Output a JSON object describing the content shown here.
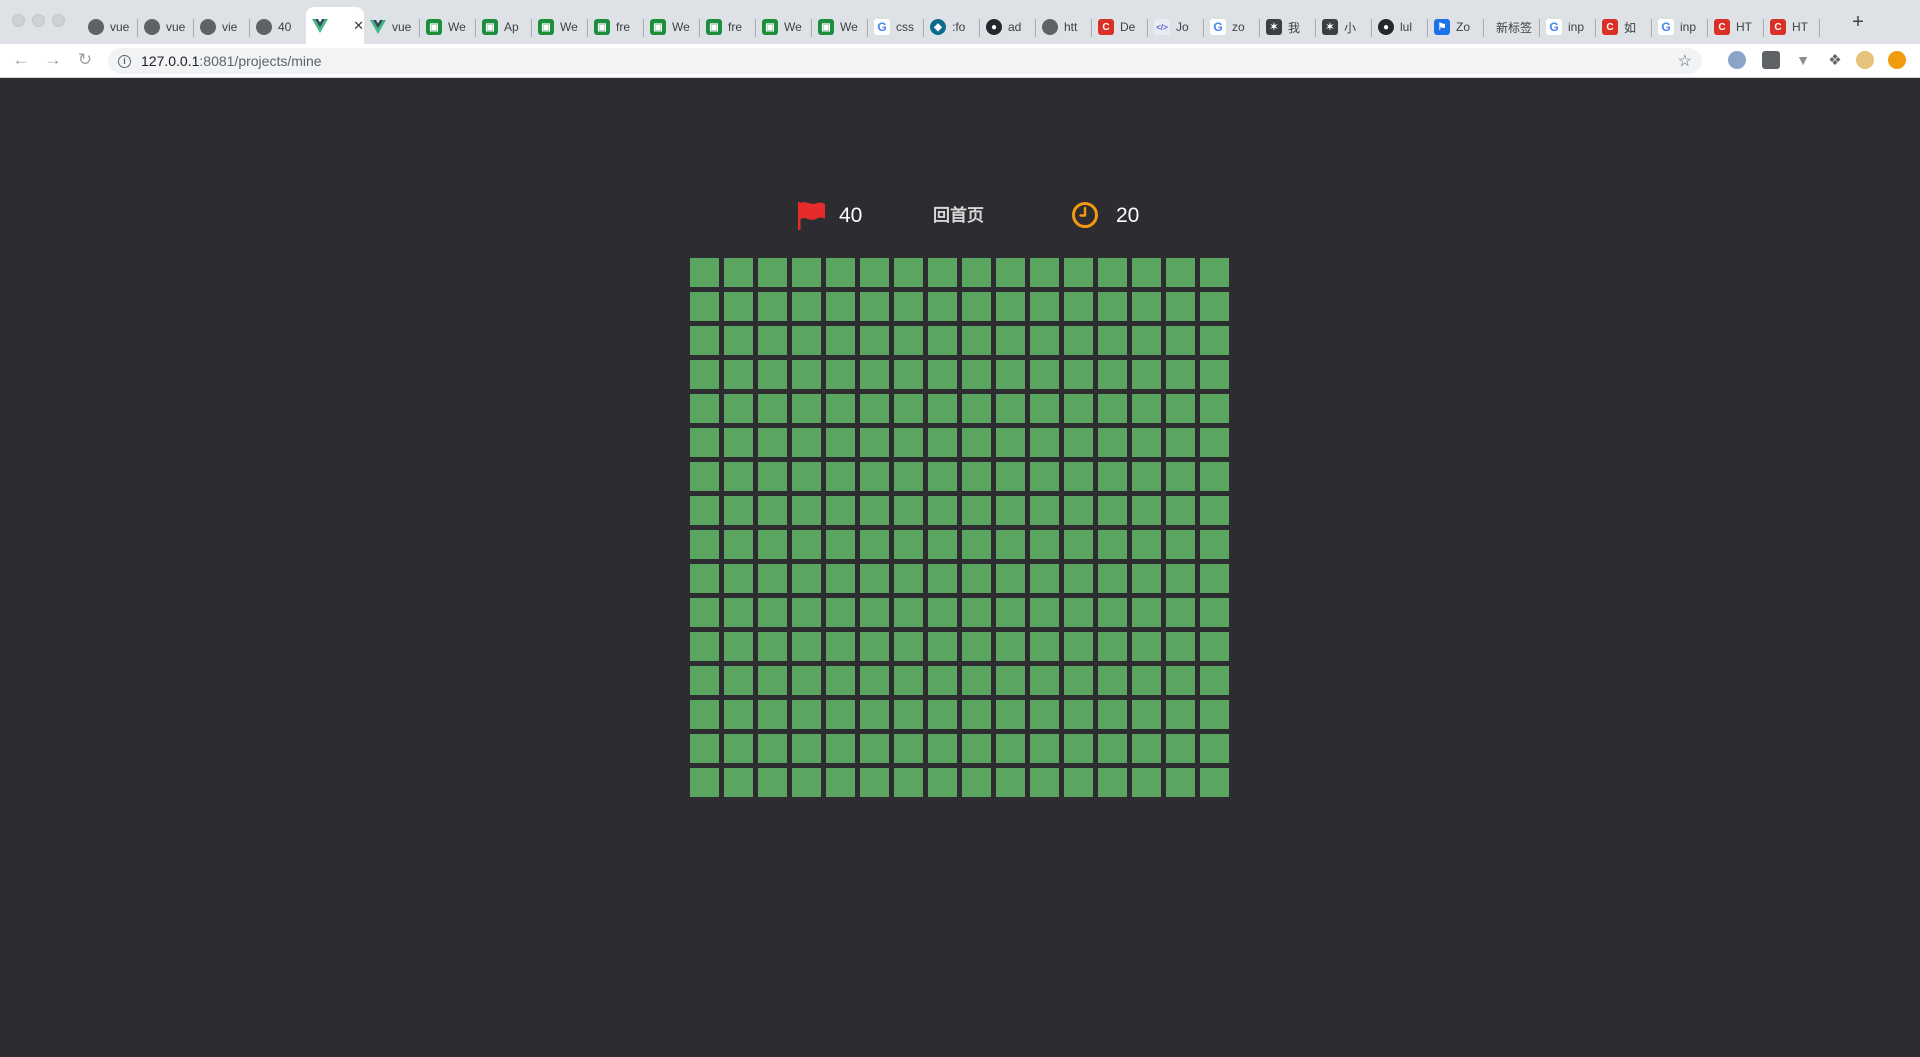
{
  "browser": {
    "tabs": [
      {
        "title": "vue",
        "favicon": "globe-icon",
        "kind": "globe"
      },
      {
        "title": "vue",
        "favicon": "globe-icon",
        "kind": "globe"
      },
      {
        "title": "vie",
        "favicon": "globe-icon",
        "kind": "globe"
      },
      {
        "title": "40",
        "favicon": "globe-icon",
        "kind": "globe"
      },
      {
        "title": "",
        "favicon": "vue-icon",
        "kind": "vue",
        "active": true
      },
      {
        "title": "vue",
        "favicon": "vue-icon",
        "kind": "vue"
      },
      {
        "title": "We",
        "favicon": "green-doc-icon",
        "kind": "green"
      },
      {
        "title": "Ap",
        "favicon": "green-doc-icon",
        "kind": "green"
      },
      {
        "title": "We",
        "favicon": "green-doc-icon",
        "kind": "green"
      },
      {
        "title": "fre",
        "favicon": "green-doc-icon",
        "kind": "green"
      },
      {
        "title": "We",
        "favicon": "green-doc-icon",
        "kind": "green"
      },
      {
        "title": "fre",
        "favicon": "green-doc-icon",
        "kind": "green"
      },
      {
        "title": "We",
        "favicon": "green-doc-icon",
        "kind": "green"
      },
      {
        "title": "We",
        "favicon": "green-doc-icon",
        "kind": "green"
      },
      {
        "title": "css",
        "favicon": "google-icon",
        "kind": "g"
      },
      {
        "title": ":fo",
        "favicon": "bird-icon",
        "kind": "teal"
      },
      {
        "title": "ad",
        "favicon": "github-icon",
        "kind": "gh"
      },
      {
        "title": "htt",
        "favicon": "globe-icon",
        "kind": "globe"
      },
      {
        "title": "De",
        "favicon": "red-logo-icon",
        "kind": "red"
      },
      {
        "title": "Jo",
        "favicon": "code-icon",
        "kind": "purple"
      },
      {
        "title": "zo",
        "favicon": "google-icon",
        "kind": "g"
      },
      {
        "title": "我",
        "favicon": "dark-logo-icon",
        "kind": "dark"
      },
      {
        "title": "小",
        "favicon": "dark-logo-icon",
        "kind": "dark"
      },
      {
        "title": "lul",
        "favicon": "github-icon",
        "kind": "gh"
      },
      {
        "title": "Zo",
        "favicon": "flag-blue-icon",
        "kind": "blue"
      },
      {
        "title": "新标签",
        "favicon": "",
        "kind": "none",
        "wide": true
      },
      {
        "title": "inp",
        "favicon": "google-icon",
        "kind": "g"
      },
      {
        "title": "如",
        "favicon": "red-c-icon",
        "kind": "red"
      },
      {
        "title": "inp",
        "favicon": "google-icon",
        "kind": "g"
      },
      {
        "title": "HT",
        "favicon": "red-c-icon",
        "kind": "red"
      },
      {
        "title": "HT",
        "favicon": "red-c-icon",
        "kind": "red"
      }
    ],
    "url_host": "127.0.0.1",
    "url_rest": ":8081/projects/mine"
  },
  "game": {
    "flags_remaining": "40",
    "home_label": "回首页",
    "timer": "20",
    "rows": 16,
    "cols": 16,
    "colors": {
      "cell": "#5aa560",
      "background": "#2d2c31",
      "flag": "#e52b2b",
      "clock": "#f29b0f"
    }
  }
}
